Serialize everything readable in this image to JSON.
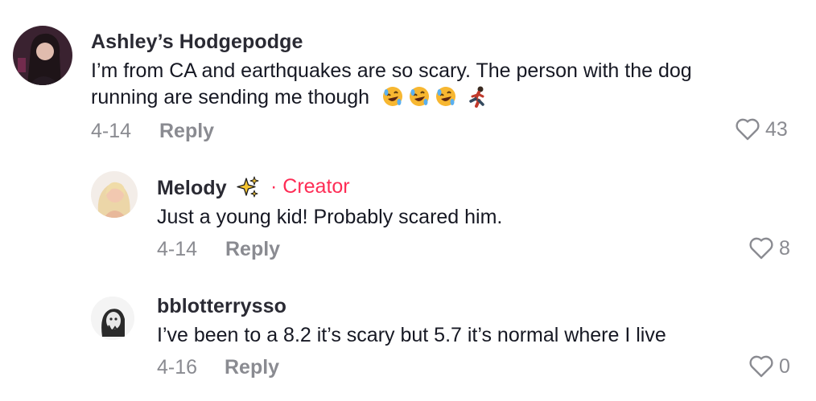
{
  "comments": [
    {
      "username": "Ashley’s Hodgepodge",
      "text_line1": "I’m from CA and earthquakes are so scary. The person with the dog",
      "text_line2": "running are sending me though",
      "emojis": [
        "rolling-on-floor-laughing-icon",
        "rolling-on-floor-laughing-icon",
        "rolling-on-floor-laughing-icon",
        "person-running-icon"
      ],
      "date": "4-14",
      "reply_label": "Reply",
      "likes": "43"
    },
    {
      "username": "Melody",
      "username_emoji": "sparkles-icon",
      "creator_label": "· Creator",
      "text": "Just a young kid! Probably scared him.",
      "date": "4-14",
      "reply_label": "Reply",
      "likes": "8"
    },
    {
      "username": "bblotterrysso",
      "text": "I’ve been to a 8.2 it’s scary but 5.7 it’s normal where I live",
      "date": "4-16",
      "reply_label": "Reply",
      "likes": "0"
    }
  ],
  "colors": {
    "creator": "#fe2c55",
    "meta": "#8a8b91",
    "text": "#161823"
  }
}
